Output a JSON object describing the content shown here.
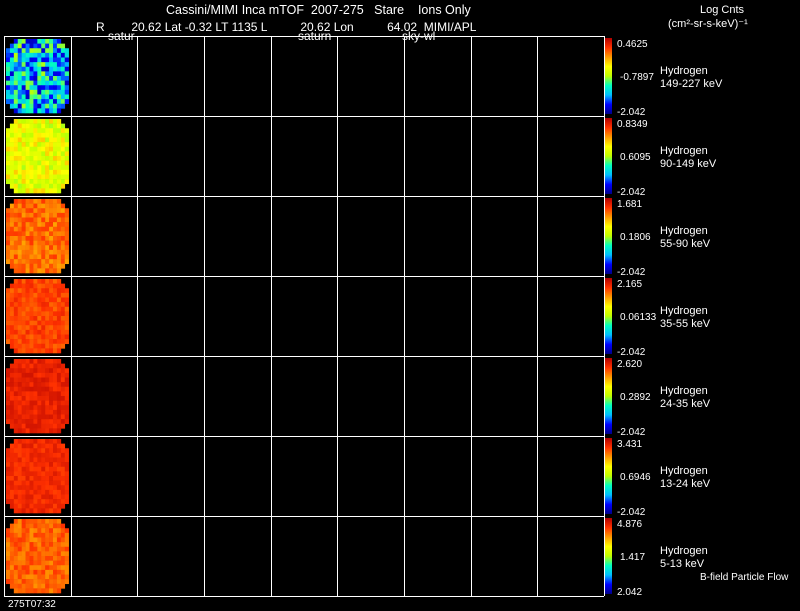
{
  "header": {
    "title": "Cassini/MIMI Inca mTOF  2007-275   Stare    Ions Only",
    "subtitle": "R        20.62 Lat -0.32 LT 1135 L          20.62 Lon          64.02  MIMI/APL",
    "label_satur": "satur",
    "label_saturn": "saturn",
    "label_sky": "sky-wl",
    "units_line1": "Log Cnts",
    "units_line2": "(cm²-sr-s-keV)⁻¹"
  },
  "footer": {
    "timestamp": "275T07:32",
    "flow_label": "B-field Particle Flow"
  },
  "chart_data": {
    "type": "heatmap",
    "title": "Cassini/MIMI Inca mTOF  2007-275   Stare    Ions Only",
    "grid": true,
    "grid_columns": 9,
    "colormap": [
      "#00008a",
      "#0000ff",
      "#00bfff",
      "#00ffc0",
      "#c0ff00",
      "#ffff00",
      "#ff9a00",
      "#ff3000",
      "#b00000"
    ],
    "panels": [
      {
        "species": "Hydrogen",
        "energy": "149-227 keV",
        "cmax": "0.4625",
        "cmid": "-0.7897",
        "cmin": "-2.042",
        "image_mean": -1.35,
        "image_spread": 0.55
      },
      {
        "species": "Hydrogen",
        "energy": "90-149 keV",
        "cmax": "0.8349",
        "cmid": "0.6095",
        "cmin": "-2.042",
        "image_mean": -0.35,
        "image_spread": 0.3
      },
      {
        "species": "Hydrogen",
        "energy": "55-90 keV",
        "cmax": "1.681",
        "cmid": "0.1806",
        "cmin": "-2.042",
        "image_mean": 0.95,
        "image_spread": 0.25
      },
      {
        "species": "Hydrogen",
        "energy": "35-55 keV",
        "cmax": "2.165",
        "cmid": "0.06133",
        "cmin": "-2.042",
        "image_mean": 1.55,
        "image_spread": 0.2
      },
      {
        "species": "Hydrogen",
        "energy": "24-35 keV",
        "cmax": "2.620",
        "cmid": "0.2892",
        "cmin": "-2.042",
        "image_mean": 2.2,
        "image_spread": 0.18
      },
      {
        "species": "Hydrogen",
        "energy": "13-24 keV",
        "cmax": "3.431",
        "cmid": "0.6946",
        "cmin": "-2.042",
        "image_mean": 2.85,
        "image_spread": 0.2
      },
      {
        "species": "Hydrogen",
        "energy": "5-13 keV",
        "cmax": "4.876",
        "cmid": "1.417",
        "cmin": "2.042",
        "image_mean": 3.6,
        "image_spread": 0.4
      }
    ]
  }
}
